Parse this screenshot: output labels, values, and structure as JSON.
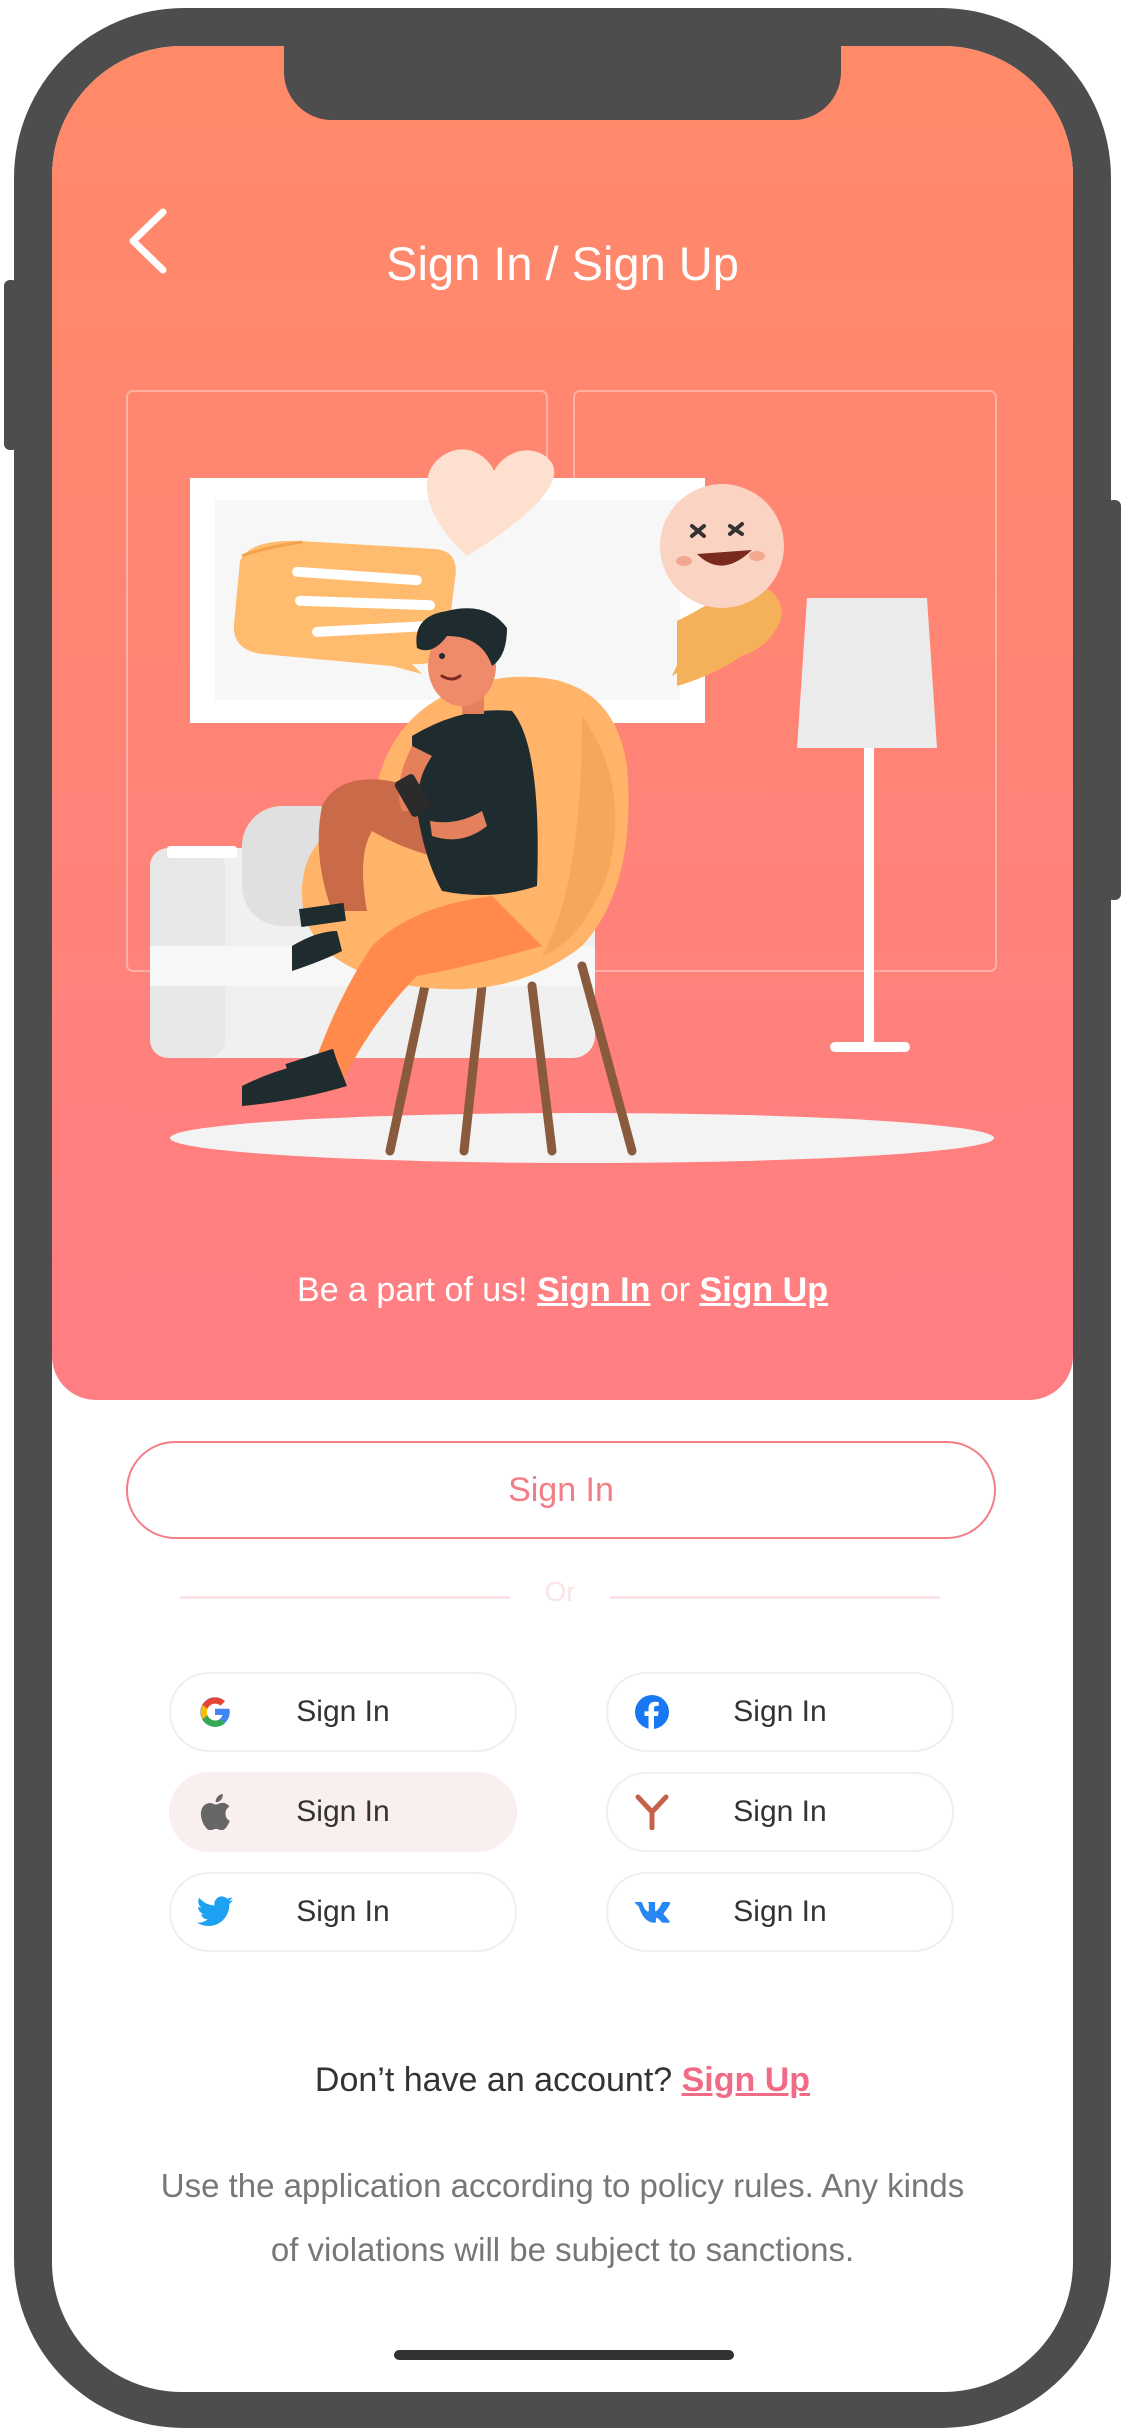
{
  "header": {
    "title": "Sign In / Sign Up"
  },
  "hero": {
    "tagline_prefix": "Be a part of us!",
    "signin_link": "Sign In",
    "or_text": "or",
    "signup_link": "Sign Up"
  },
  "main_button": {
    "label": "Sign In"
  },
  "divider": {
    "label": "Or"
  },
  "social": [
    {
      "provider": "google",
      "icon": "google-icon",
      "label": "Sign In"
    },
    {
      "provider": "facebook",
      "icon": "facebook-icon",
      "label": "Sign In"
    },
    {
      "provider": "apple",
      "icon": "apple-icon",
      "label": "Sign In"
    },
    {
      "provider": "yandex",
      "icon": "yandex-icon",
      "label": "Sign In"
    },
    {
      "provider": "twitter",
      "icon": "twitter-icon",
      "label": "Sign In"
    },
    {
      "provider": "vk",
      "icon": "vk-icon",
      "label": "Sign In"
    }
  ],
  "footer": {
    "question": "Don’t have an account?",
    "signup_link": "Sign Up",
    "policy": "Use the application according to policy rules. Any kinds of violations will be subject to sanctions."
  },
  "colors": {
    "gradient_top": "#ff8a68",
    "gradient_bottom": "#ff7e84",
    "accent": "#f27d87",
    "link": "#f06b86"
  }
}
